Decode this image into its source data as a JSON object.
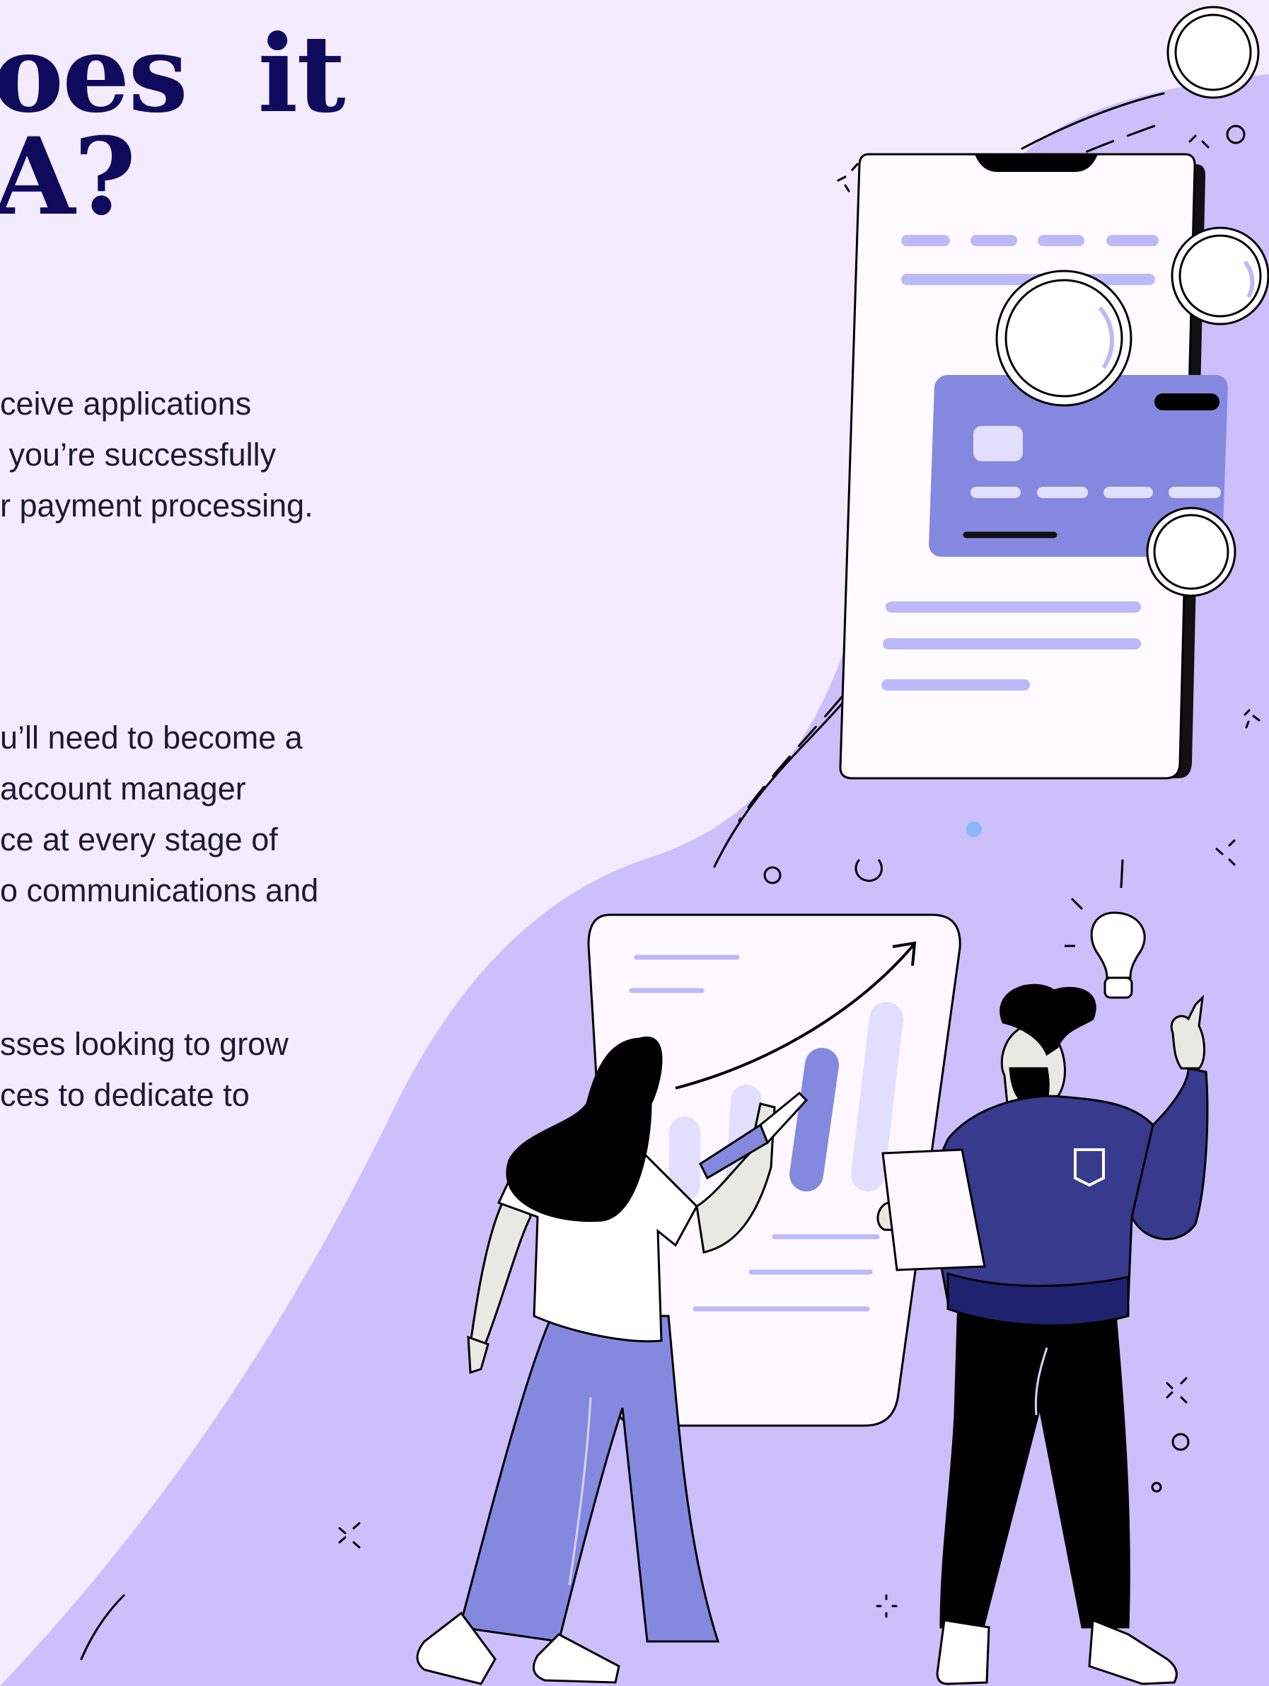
{
  "heading": {
    "line1": "oes  it",
    "line2": "A?"
  },
  "paragraphs": [
    {
      "lines": [
        "ceive applications",
        " you’re successfully",
        "r payment processing."
      ]
    },
    {
      "lines": [
        "u’ll need to become a",
        "account manager",
        "ce at every stage of",
        "o communications and"
      ]
    },
    {
      "lines": [
        "sses looking to grow",
        "ces to dedicate to"
      ]
    }
  ],
  "colors": {
    "page_background": "#f3ecfe",
    "blob": "#cbbffc",
    "heading": "#0f0a5c",
    "body_text": "#1c1a33",
    "accent_purple": "#8489df",
    "navy_sweater": "#373a8d",
    "light_lavender": "#c4c2fb"
  },
  "illustration": {
    "icons": [
      "smartphone-icon",
      "credit-card-icon",
      "coin-icon",
      "growth-chart-icon",
      "lightbulb-icon",
      "woman-figure",
      "man-figure",
      "clipboard-icon",
      "pencil-icon",
      "sparkle-icon"
    ]
  }
}
